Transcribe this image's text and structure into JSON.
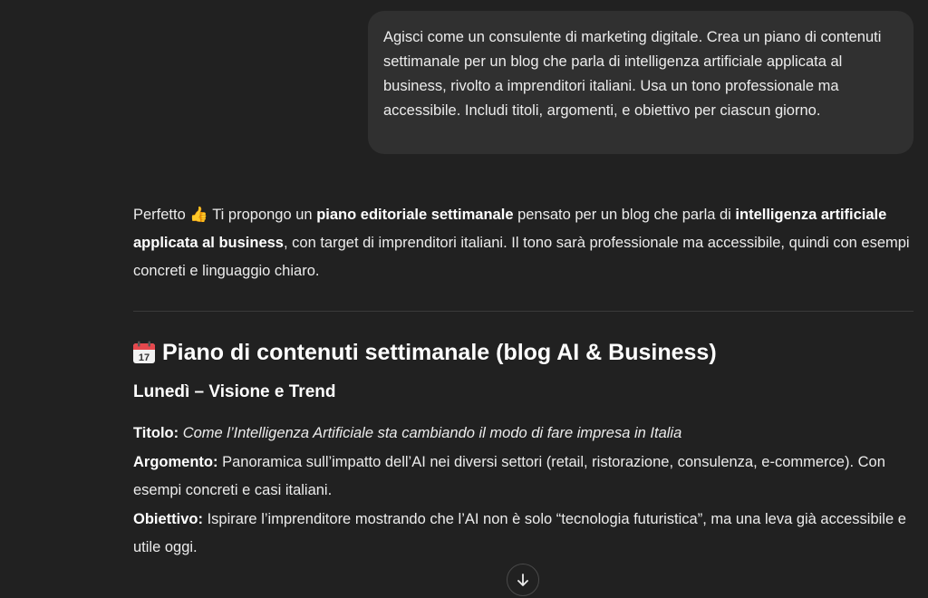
{
  "user_message": "Agisci come un consulente di marketing digitale. Crea un piano di contenuti settimanale per un blog che parla di intelligenza artificiale applicata al business, rivolto a imprenditori italiani. Usa un tono professionale ma accessibile. Includi titoli, argomenti, e obiettivo per ciascun giorno.",
  "assistant": {
    "intro": {
      "p1": "Perfetto ",
      "emoji": "👍",
      "p2": " Ti propongo un ",
      "b1": "piano editoriale settimanale",
      "p3": " pensato per un blog che parla di ",
      "b2": "intelligenza artificiale applicata al business",
      "p4": ", con target di imprenditori italiani. Il tono sarà professionale ma accessibile, quindi con esempi concreti e linguaggio chiaro."
    },
    "heading": "Piano di contenuti settimanale (blog AI & Business)",
    "heading_icon": "calendar-icon",
    "day": {
      "title": "Lunedì – Visione e Trend",
      "titolo_label": "Titolo:",
      "titolo_value": "Come l’Intelligenza Artificiale sta cambiando il modo di fare impresa in Italia",
      "argomento_label": "Argomento:",
      "argomento_value": "Panoramica sull’impatto dell’AI nei diversi settori (retail, ristorazione, consulenza, e-commerce). Con esempi concreti e casi italiani.",
      "obiettivo_label": "Obiettivo:",
      "obiettivo_value": "Ispirare l’imprenditore mostrando che l’AI non è solo “tecnologia futuristica”, ma una leva già accessibile e utile oggi."
    }
  },
  "calendar_icon_text": "17",
  "scroll_button_icon": "arrow-down-icon",
  "colors": {
    "background": "#212121",
    "user_bubble": "#303030",
    "text": "#ececec",
    "calendar_red": "#e5484d"
  }
}
